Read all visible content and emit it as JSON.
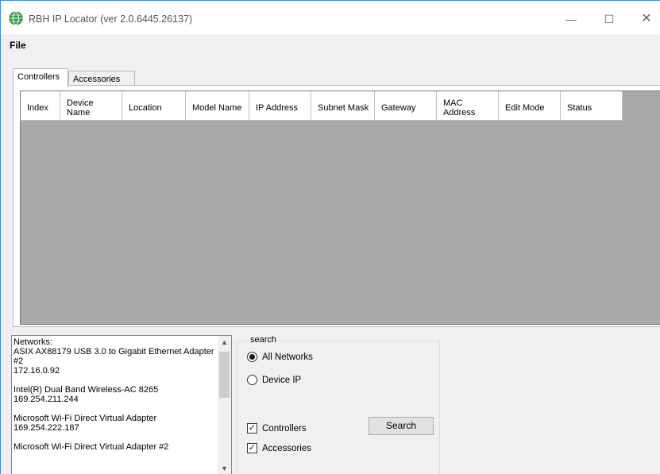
{
  "window": {
    "title": "RBH IP Locator (ver 2.0.6445.26137)",
    "minimize_glyph": "—",
    "maximize_glyph": "☐",
    "close_glyph": "✕"
  },
  "menu": {
    "file": "File"
  },
  "tabs": {
    "controllers": "Controllers",
    "accessories": "Accessories"
  },
  "grid": {
    "columns": [
      {
        "label": "Index"
      },
      {
        "label": "Device Name"
      },
      {
        "label": "Location"
      },
      {
        "label": "Model Name"
      },
      {
        "label": "IP Address"
      },
      {
        "label": "Subnet Mask"
      },
      {
        "label": "Gateway"
      },
      {
        "label": "MAC Address"
      },
      {
        "label": "Edit Mode"
      },
      {
        "label": "Status"
      }
    ]
  },
  "networks": {
    "text": "Networks:\nASIX AX88179 USB 3.0 to Gigabit Ethernet Adapter #2\n172.16.0.92\n\nIntel(R) Dual Band Wireless-AC 8265\n169.254.211.244\n\nMicrosoft Wi-Fi Direct Virtual Adapter\n169.254.222.187\n\nMicrosoft Wi-Fi Direct Virtual Adapter #2"
  },
  "search": {
    "legend": "search",
    "all_networks": "All Networks",
    "device_ip": "Device IP",
    "controllers": "Controllers",
    "accessories": "Accessories",
    "button": "Search"
  },
  "icons": {
    "app": "globe-icon",
    "scroll_up": "chevron-up-icon",
    "scroll_down": "chevron-down-icon"
  },
  "colors": {
    "accent_border": "#3a8ee6",
    "grid_background": "#a9a9a9"
  }
}
